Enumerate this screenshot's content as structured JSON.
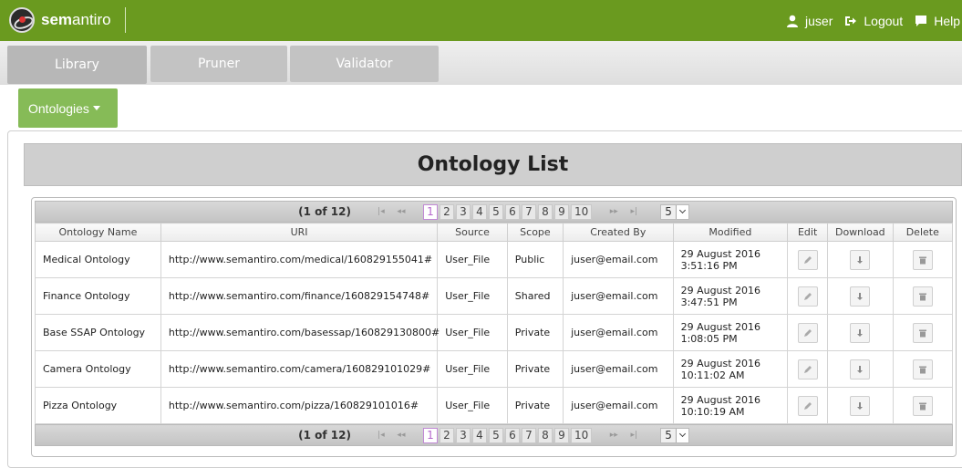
{
  "app": {
    "brand_bold": "sem",
    "brand_rest": "antiro"
  },
  "topnav": {
    "user": "juser",
    "logout": "Logout",
    "help": "Help"
  },
  "tabs": [
    "Library",
    "Pruner",
    "Validator"
  ],
  "active_tab": "Library",
  "dropdown": {
    "label": "Ontologies"
  },
  "list_title": "Ontology List",
  "pager": {
    "count": "(1 of 12)",
    "first": "|◂",
    "prev": "◂◂",
    "next": "▸▸",
    "last": "▸|",
    "pages": [
      "1",
      "2",
      "3",
      "4",
      "5",
      "6",
      "7",
      "8",
      "9",
      "10"
    ],
    "active_page": "1",
    "page_size": "5"
  },
  "table": {
    "columns": [
      "Ontology Name",
      "URI",
      "Source",
      "Scope",
      "Created By",
      "Modified",
      "Edit",
      "Download",
      "Delete"
    ],
    "rows": [
      {
        "name": "Medical Ontology",
        "uri": "http://www.semantiro.com/medical/160829155041#",
        "source": "User_File",
        "scope": "Public",
        "created_by": "juser@email.com",
        "modified_date": "29 August 2016",
        "modified_time": "3:51:16 PM"
      },
      {
        "name": "Finance Ontology",
        "uri": "http://www.semantiro.com/finance/160829154748#",
        "source": "User_File",
        "scope": "Shared",
        "created_by": "juser@email.com",
        "modified_date": "29 August 2016",
        "modified_time": "3:47:51 PM"
      },
      {
        "name": "Base SSAP Ontology",
        "uri": "http://www.semantiro.com/basessap/160829130800#",
        "source": "User_File",
        "scope": "Private",
        "created_by": "juser@email.com",
        "modified_date": "29 August 2016",
        "modified_time": "1:08:05 PM"
      },
      {
        "name": "Camera Ontology",
        "uri": "http://www.semantiro.com/camera/160829101029#",
        "source": "User_File",
        "scope": "Private",
        "created_by": "juser@email.com",
        "modified_date": "29 August 2016",
        "modified_time": "10:11:02 AM"
      },
      {
        "name": "Pizza Ontology",
        "uri": "http://www.semantiro.com/pizza/160829101016#",
        "source": "User_File",
        "scope": "Private",
        "created_by": "juser@email.com",
        "modified_date": "29 August 2016",
        "modified_time": "10:10:19 AM"
      }
    ]
  },
  "icons": {
    "edit": "pencil-icon",
    "download": "download-arrow-icon",
    "delete": "trash-icon",
    "user": "user-icon",
    "logout": "logout-icon",
    "help": "chat-bubble-icon"
  },
  "colors": {
    "topbar": "#6a9a1f",
    "dropdown": "#86bb57",
    "tab": "#c3c3c3",
    "active_page_border": "#c28ad6"
  }
}
